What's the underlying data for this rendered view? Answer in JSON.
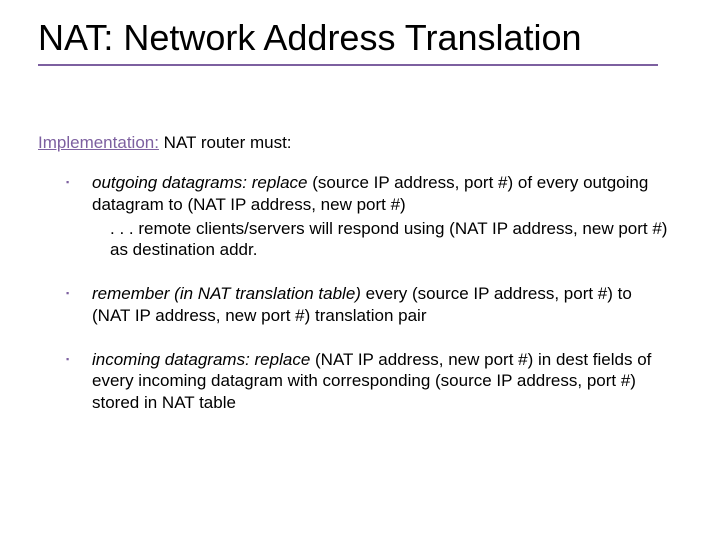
{
  "title": "NAT: Network Address Translation",
  "subtitle_label": "Implementation:",
  "subtitle_rest": " NAT router must:",
  "bullets": [
    {
      "lead": "outgoing datagrams: replace",
      "rest": " (source IP address, port #) of every outgoing datagram to (NAT IP address, new port #)",
      "sub": ". . . remote clients/servers will respond using (NAT IP address, new port #) as destination addr."
    },
    {
      "lead": "remember (in NAT translation table)",
      "rest": " every (source IP address, port #)  to (NAT IP address, new port #) translation pair",
      "sub": ""
    },
    {
      "lead": "incoming datagrams: replace",
      "rest": " (NAT IP address, new port #) in dest fields of every incoming datagram with corresponding (source IP address, port #) stored in NAT table",
      "sub": ""
    }
  ]
}
